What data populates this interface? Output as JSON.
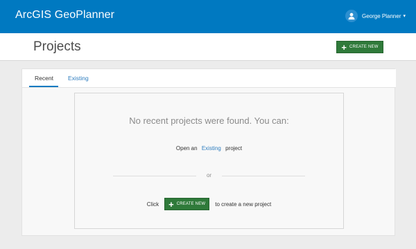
{
  "topbar": {
    "app_title": "ArcGIS GeoPlanner",
    "user_name": "George Planner",
    "user_caret": "▾"
  },
  "header": {
    "page_title": "Projects",
    "create_button": {
      "icon": "plus-icon",
      "plus": "+",
      "label": "CREATE NEW"
    }
  },
  "tabs": [
    {
      "label": "Recent",
      "active": true
    },
    {
      "label": "Existing",
      "active": false
    }
  ],
  "empty_state": {
    "message": "No recent projects were found. You can:",
    "open_prefix": "Open an",
    "open_link": "Existing",
    "open_suffix": "project",
    "or_text": "or",
    "click_prefix": "Click",
    "create_button": {
      "icon": "plus-icon",
      "plus": "+",
      "label": "CREATE NEW"
    },
    "click_suffix": "to create a new project"
  },
  "colors": {
    "topbar": "#0079c1",
    "button_green": "#2f7a3a",
    "link_blue": "#2e7dbf",
    "page_bg": "#ececec"
  }
}
